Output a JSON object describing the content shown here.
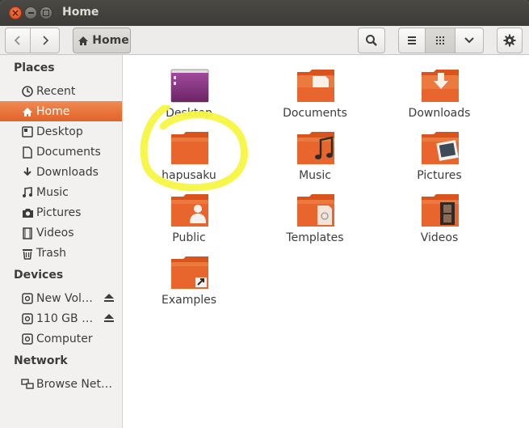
{
  "window": {
    "title": "Home"
  },
  "toolbar": {
    "location": "Home",
    "icons": [
      "back-arrow-icon",
      "forward-arrow-icon",
      "home-icon",
      "search-icon",
      "list-view-icon",
      "grid-view-icon",
      "chevron-down-icon",
      "gear-icon"
    ]
  },
  "sidebar": {
    "places_heading": "Places",
    "places": [
      {
        "label": "Recent",
        "icon": "clock-icon"
      },
      {
        "label": "Home",
        "icon": "home-icon",
        "active": true
      },
      {
        "label": "Desktop",
        "icon": "desktop-icon"
      },
      {
        "label": "Documents",
        "icon": "document-icon"
      },
      {
        "label": "Downloads",
        "icon": "download-icon"
      },
      {
        "label": "Music",
        "icon": "music-icon"
      },
      {
        "label": "Pictures",
        "icon": "camera-icon"
      },
      {
        "label": "Videos",
        "icon": "film-icon"
      },
      {
        "label": "Trash",
        "icon": "trash-icon"
      }
    ],
    "devices_heading": "Devices",
    "devices": [
      {
        "label": "New Vol…",
        "icon": "drive-icon",
        "eject": true
      },
      {
        "label": "110 GB …",
        "icon": "drive-icon",
        "eject": true
      },
      {
        "label": "Computer",
        "icon": "drive-icon"
      }
    ],
    "network_heading": "Network",
    "network": [
      {
        "label": "Browse Net…",
        "icon": "network-icon"
      }
    ]
  },
  "files": [
    {
      "name": "Desktop",
      "icon": "desktop-folder-icon"
    },
    {
      "name": "Documents",
      "icon": "documents-folder-icon"
    },
    {
      "name": "Downloads",
      "icon": "downloads-folder-icon"
    },
    {
      "name": "hapusaku",
      "icon": "folder-icon"
    },
    {
      "name": "Music",
      "icon": "music-folder-icon"
    },
    {
      "name": "Pictures",
      "icon": "pictures-folder-icon"
    },
    {
      "name": "Public",
      "icon": "public-folder-icon"
    },
    {
      "name": "Templates",
      "icon": "templates-folder-icon"
    },
    {
      "name": "Videos",
      "icon": "videos-folder-icon"
    },
    {
      "name": "Examples",
      "icon": "examples-folder-icon"
    }
  ],
  "colors": {
    "accent": "#e9793c",
    "folder": "#e8662e",
    "highlight_annotation": "#f5f542",
    "titlebar": "#3c3b37"
  }
}
